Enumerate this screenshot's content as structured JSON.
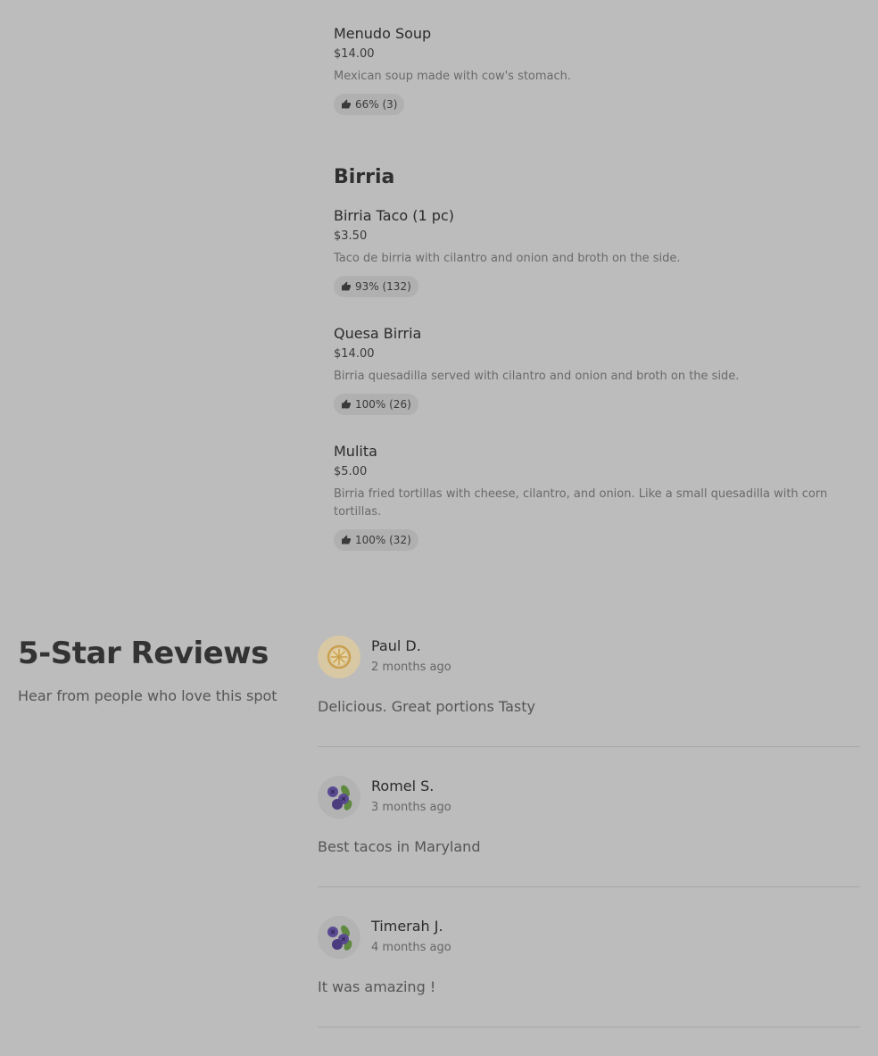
{
  "menu": {
    "items_top": [
      {
        "name": "Menudo Soup",
        "price": "$14.00",
        "description": "Mexican soup made with cow's stomach.",
        "rating": "66% (3)"
      }
    ],
    "sections": [
      {
        "title": "Birria",
        "items": [
          {
            "name": "Birria Taco (1 pc)",
            "price": "$3.50",
            "description": "Taco de birria with cilantro and onion and broth on the side.",
            "rating": "93% (132)"
          },
          {
            "name": "Quesa Birria",
            "price": "$14.00",
            "description": "Birria quesadilla served with cilantro and onion and broth on the side.",
            "rating": "100% (26)"
          },
          {
            "name": "Mulita",
            "price": "$5.00",
            "description": "Birria fried tortillas with cheese, cilantro, and onion. Like a small quesadilla with corn tortillas.",
            "rating": "100% (32)"
          }
        ]
      }
    ]
  },
  "reviews": {
    "title": "5-Star Reviews",
    "subtitle": "Hear from people who love this spot",
    "list": [
      {
        "name": "Paul D.",
        "date": "2 months ago",
        "text": "Delicious. Great portions Tasty",
        "avatar": "lemon-slice-icon"
      },
      {
        "name": "Romel S.",
        "date": "3 months ago",
        "text": "Best tacos in Maryland",
        "avatar": "blueberries-icon"
      },
      {
        "name": "Timerah J.",
        "date": "4 months ago",
        "text": "It was amazing !",
        "avatar": "blueberries-icon"
      }
    ]
  },
  "colors": {
    "overlay_background": "#bcbcbc",
    "badge_background": "#b0b0b0",
    "lemon_avatar_bg": "#d9c8a4",
    "blueberry_avatar_bg": "#b3b3b3"
  }
}
